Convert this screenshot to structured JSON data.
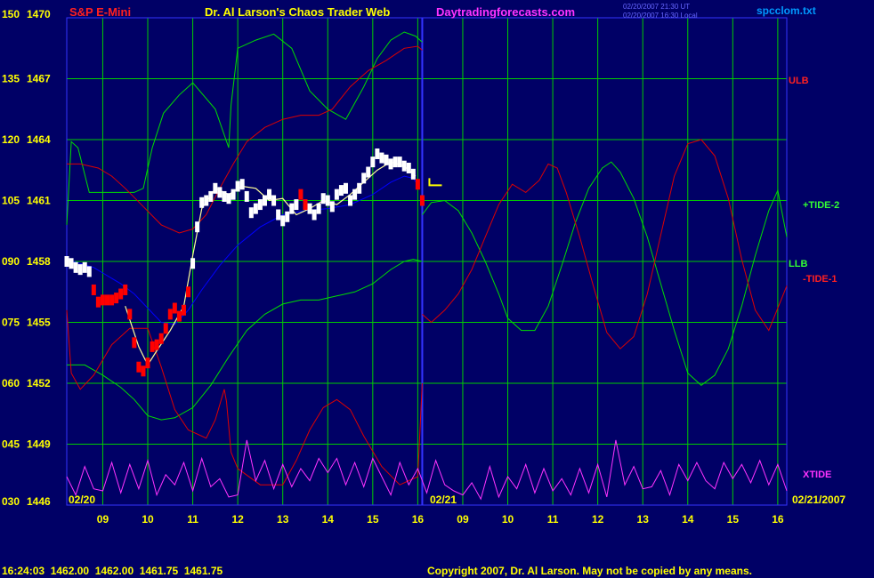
{
  "header": {
    "instrument": "S&P E-Mini",
    "site_title": "Dr. Al Larson's Chaos Trader Web",
    "site_url": "Daytradingforecasts.com",
    "timestamp_line1": "02/20/2007 21:30 UT",
    "timestamp_line2": "02/20/2007 16:30 Local",
    "data_file": "spcclom.txt"
  },
  "footer": {
    "quote": "16:24:03  1462.00  1462.00  1461.75  1461.75",
    "copyright": "Copyright 2007, Dr. Al Larson. May not be copied by any means."
  },
  "colors": {
    "background": "#000066",
    "border": "#000000",
    "grid": "#00cc00",
    "axis_text": "#ffff00",
    "title_red": "#ff2020",
    "title_yellow": "#ffff00",
    "title_magenta": "#ff33ff",
    "price_white": "#ffffff",
    "price_red": "#ff0000",
    "avg_blue": "#0000ff",
    "band_green": "#00dd00",
    "band_red": "#dd0000",
    "xtide_magenta": "#ff33ff",
    "divider_blue": "#3333ff"
  },
  "chart_data": {
    "type": "line",
    "title": "S&P E-Mini",
    "y_axis": {
      "ticks": [
        {
          "tide": "150",
          "price": "1470"
        },
        {
          "tide": "135",
          "price": "1467"
        },
        {
          "tide": "120",
          "price": "1464"
        },
        {
          "tide": "105",
          "price": "1461"
        },
        {
          "tide": "090",
          "price": "1458"
        },
        {
          "tide": "075",
          "price": "1455"
        },
        {
          "tide": "060",
          "price": "1452"
        },
        {
          "tide": "045",
          "price": "1449"
        },
        {
          "tide": "030",
          "price": "1446"
        }
      ],
      "price_range": [
        1446,
        1470
      ]
    },
    "x_axis": {
      "range": [
        8.2,
        24.2
      ],
      "ticks": [
        {
          "x": 9,
          "label": "09"
        },
        {
          "x": 10,
          "label": "10"
        },
        {
          "x": 11,
          "label": "11"
        },
        {
          "x": 12,
          "label": "12"
        },
        {
          "x": 13,
          "label": "13"
        },
        {
          "x": 14,
          "label": "14"
        },
        {
          "x": 15,
          "label": "15"
        },
        {
          "x": 16,
          "label": "16"
        },
        {
          "x": 17,
          "label": "09"
        },
        {
          "x": 18,
          "label": "10"
        },
        {
          "x": 19,
          "label": "11"
        },
        {
          "x": 20,
          "label": "12"
        },
        {
          "x": 21,
          "label": "13"
        },
        {
          "x": 22,
          "label": "14"
        },
        {
          "x": 23,
          "label": "15"
        },
        {
          "x": 24,
          "label": "16"
        }
      ],
      "date_left": "02/20",
      "date_mid": "02/21",
      "date_right": "02/21/2007",
      "divider_x": 16.1
    },
    "series_labels": {
      "ulb": "ULB",
      "tide2": "+TIDE-2",
      "llb": "LLB",
      "tide1": "-TIDE-1",
      "xtide": "XTIDE"
    },
    "series": [
      {
        "key": "upper_green",
        "color": "#00dd00",
        "x": [
          8.2,
          8.3,
          8.45,
          8.7,
          9.0,
          9.4,
          9.7,
          9.9,
          10.1,
          10.35,
          10.7,
          11.0,
          11.5,
          11.8,
          11.85,
          12.0,
          12.4,
          12.8,
          13.2,
          13.6,
          14.0,
          14.4,
          14.8,
          15.1,
          15.4,
          15.7,
          15.95,
          16.1
        ],
        "y": [
          1459.8,
          1463.9,
          1463.6,
          1461.4,
          1461.4,
          1461.4,
          1461.4,
          1461.6,
          1463.6,
          1465.3,
          1466.2,
          1466.8,
          1465.5,
          1463.6,
          1465.7,
          1468.5,
          1468.9,
          1469.2,
          1468.5,
          1466.4,
          1465.5,
          1465.0,
          1466.6,
          1468.0,
          1468.9,
          1469.3,
          1469.1,
          1468.8
        ]
      },
      {
        "key": "upper_red",
        "color": "#dd0000",
        "x": [
          8.2,
          8.5,
          8.9,
          9.2,
          9.5,
          9.9,
          10.3,
          10.7,
          11.0,
          11.3,
          11.6,
          11.9,
          12.2,
          12.6,
          13.0,
          13.4,
          13.8,
          14.1,
          14.5,
          14.9,
          15.3,
          15.7,
          16.0,
          16.1
        ],
        "y": [
          1462.8,
          1462.8,
          1462.6,
          1462.2,
          1461.6,
          1460.7,
          1459.8,
          1459.4,
          1459.6,
          1460.3,
          1461.6,
          1462.8,
          1463.9,
          1464.6,
          1465.0,
          1465.2,
          1465.2,
          1465.5,
          1466.6,
          1467.4,
          1467.9,
          1468.5,
          1468.6,
          1468.4
        ]
      },
      {
        "key": "lower_green",
        "color": "#00dd00",
        "x": [
          8.2,
          8.6,
          9.0,
          9.4,
          9.7,
          10.0,
          10.3,
          10.6,
          11.0,
          11.4,
          11.8,
          12.2,
          12.6,
          13.0,
          13.4,
          13.8,
          14.2,
          14.6,
          15.0,
          15.4,
          15.7,
          15.9,
          16.1
        ],
        "y": [
          1452.9,
          1452.9,
          1452.4,
          1451.8,
          1451.2,
          1450.4,
          1450.2,
          1450.3,
          1450.8,
          1451.9,
          1453.3,
          1454.6,
          1455.4,
          1455.9,
          1456.1,
          1456.1,
          1456.3,
          1456.5,
          1456.9,
          1457.6,
          1458.0,
          1458.1,
          1458.0
        ]
      },
      {
        "key": "lower_red",
        "color": "#dd0000",
        "x": [
          8.2,
          8.3,
          8.5,
          8.8,
          9.2,
          9.6,
          10.0,
          10.3,
          10.6,
          10.9,
          11.3,
          11.5,
          11.7,
          11.75,
          11.85,
          12.0,
          12.5,
          13.0,
          13.3,
          13.6,
          13.9,
          14.2,
          14.5,
          14.8,
          15.2,
          15.6,
          16.0,
          16.1
        ],
        "y": [
          1455.6,
          1452.5,
          1451.7,
          1452.4,
          1453.9,
          1454.7,
          1454.7,
          1452.8,
          1450.7,
          1449.7,
          1449.3,
          1450.2,
          1451.7,
          1451.1,
          1448.6,
          1447.8,
          1447.0,
          1447.0,
          1448.2,
          1449.7,
          1450.8,
          1451.2,
          1450.7,
          1449.4,
          1447.9,
          1447.0,
          1447.4,
          1452.0
        ]
      },
      {
        "key": "tide2",
        "color": "#00dd00",
        "x": [
          16.1,
          16.3,
          16.6,
          16.9,
          17.2,
          17.5,
          17.8,
          18.0,
          18.3,
          18.6,
          18.9,
          19.2,
          19.5,
          19.8,
          20.1,
          20.3,
          20.5,
          20.8,
          21.1,
          21.4,
          21.7,
          22.0,
          22.3,
          22.6,
          22.9,
          23.2,
          23.5,
          23.8,
          24.0,
          24.2
        ],
        "y": [
          1460.3,
          1460.9,
          1461.0,
          1460.5,
          1459.4,
          1458.0,
          1456.4,
          1455.2,
          1454.6,
          1454.6,
          1455.8,
          1457.8,
          1459.9,
          1461.6,
          1462.6,
          1462.9,
          1462.4,
          1461.1,
          1459.2,
          1456.9,
          1454.6,
          1452.5,
          1451.9,
          1452.4,
          1453.7,
          1455.8,
          1458.3,
          1460.5,
          1461.5,
          1459.2
        ]
      },
      {
        "key": "tide1",
        "color": "#dd0000",
        "x": [
          16.1,
          16.3,
          16.6,
          16.9,
          17.2,
          17.5,
          17.8,
          18.1,
          18.4,
          18.7,
          18.9,
          19.1,
          19.3,
          19.6,
          19.9,
          20.2,
          20.5,
          20.8,
          21.1,
          21.4,
          21.7,
          22.0,
          22.3,
          22.6,
          22.9,
          23.2,
          23.5,
          23.8,
          24.2
        ],
        "y": [
          1455.4,
          1455.0,
          1455.6,
          1456.4,
          1457.6,
          1459.2,
          1460.8,
          1461.8,
          1461.4,
          1462.0,
          1462.8,
          1462.6,
          1461.4,
          1459.2,
          1456.8,
          1454.5,
          1453.7,
          1454.3,
          1456.4,
          1459.3,
          1462.2,
          1463.8,
          1464.0,
          1463.2,
          1461.1,
          1458.1,
          1455.6,
          1454.6,
          1456.8
        ]
      },
      {
        "key": "xtide",
        "color": "#ff33ff",
        "x": [
          8.2,
          8.4,
          8.6,
          8.8,
          9.0,
          9.2,
          9.4,
          9.6,
          9.8,
          10.0,
          10.2,
          10.4,
          10.6,
          10.8,
          11.0,
          11.2,
          11.4,
          11.6,
          11.8,
          12.0,
          12.2,
          12.4,
          12.6,
          12.8,
          13.0,
          13.2,
          13.4,
          13.6,
          13.8,
          14.0,
          14.2,
          14.4,
          14.6,
          14.8,
          15.0,
          15.2,
          15.4,
          15.6,
          15.8,
          16.0,
          16.2,
          16.4,
          16.6,
          16.8,
          17.0,
          17.2,
          17.4,
          17.6,
          17.8,
          18.0,
          18.2,
          18.4,
          18.6,
          18.8,
          19.0,
          19.2,
          19.4,
          19.6,
          19.8,
          20.0,
          20.2,
          20.4,
          20.6,
          20.8,
          21.0,
          21.2,
          21.4,
          21.6,
          21.8,
          22.0,
          22.2,
          22.4,
          22.6,
          22.8,
          23.0,
          23.2,
          23.4,
          23.6,
          23.8,
          24.0,
          24.2
        ],
        "y": [
          1447.4,
          1446.5,
          1447.9,
          1446.8,
          1446.7,
          1448.1,
          1446.6,
          1448.0,
          1446.8,
          1448.2,
          1446.5,
          1447.5,
          1447.0,
          1448.1,
          1446.7,
          1448.3,
          1446.9,
          1447.3,
          1446.4,
          1446.5,
          1449.2,
          1447.2,
          1448.2,
          1446.8,
          1448.0,
          1446.9,
          1447.8,
          1447.2,
          1448.3,
          1447.6,
          1448.3,
          1447.0,
          1448.1,
          1446.9,
          1448.3,
          1447.4,
          1446.5,
          1448.1,
          1447.0,
          1447.8,
          1446.6,
          1448.2,
          1447.0,
          1446.7,
          1446.5,
          1447.1,
          1446.3,
          1447.9,
          1446.4,
          1447.4,
          1446.8,
          1448.0,
          1446.6,
          1447.8,
          1446.7,
          1447.3,
          1446.5,
          1447.8,
          1446.6,
          1448.0,
          1446.4,
          1449.2,
          1447.0,
          1447.9,
          1446.8,
          1446.9,
          1447.7,
          1446.5,
          1448.0,
          1447.2,
          1448.1,
          1447.2,
          1446.8,
          1448.1,
          1447.3,
          1448.0,
          1447.1,
          1448.2,
          1447.0,
          1448.0,
          1446.7
        ]
      },
      {
        "key": "price_avg",
        "color": "#0000ff",
        "x": [
          8.2,
          8.5,
          8.8,
          9.1,
          9.4,
          9.7,
          10.0,
          10.3,
          10.6,
          10.9,
          11.2,
          11.6,
          12.0,
          12.5,
          13.0,
          13.5,
          14.0,
          14.5,
          15.0,
          15.4,
          15.7,
          15.9,
          16.05
        ],
        "y": [
          1458.1,
          1457.9,
          1457.7,
          1457.3,
          1456.9,
          1456.4,
          1455.7,
          1455.0,
          1454.9,
          1455.6,
          1456.6,
          1457.8,
          1458.8,
          1459.7,
          1460.3,
          1460.5,
          1460.6,
          1460.8,
          1461.3,
          1461.9,
          1462.2,
          1462.1,
          1461.6
        ]
      },
      {
        "key": "price_smooth",
        "color": "#ffff99",
        "x": [
          9.5,
          9.8,
          10.0,
          10.2,
          10.5,
          10.8,
          11.0,
          11.2,
          11.5,
          11.8,
          12.1,
          12.4,
          12.7,
          13.0,
          13.3,
          13.6,
          13.9,
          14.2,
          14.5,
          14.8,
          15.1,
          15.4,
          15.7,
          15.95
        ],
        "y": [
          1455.8,
          1453.8,
          1452.9,
          1453.6,
          1454.6,
          1455.8,
          1458.3,
          1460.6,
          1461.6,
          1461.3,
          1461.7,
          1461.6,
          1461.0,
          1461.1,
          1460.3,
          1460.6,
          1461.0,
          1460.8,
          1461.3,
          1461.9,
          1462.5,
          1462.9,
          1462.7,
          1462.2
        ]
      },
      {
        "key": "price_bars",
        "color": "#ffffff",
        "x": [
          8.2,
          8.3,
          8.4,
          8.5,
          8.6,
          8.7,
          8.8,
          8.9,
          9.0,
          9.1,
          9.2,
          9.3,
          9.4,
          9.5,
          9.6,
          9.7,
          9.8,
          9.9,
          10.0,
          10.1,
          10.2,
          10.3,
          10.4,
          10.5,
          10.6,
          10.7,
          10.8,
          10.9,
          11.0,
          11.1,
          11.2,
          11.3,
          11.4,
          11.5,
          11.6,
          11.7,
          11.8,
          11.9,
          12.0,
          12.1,
          12.2,
          12.3,
          12.4,
          12.5,
          12.6,
          12.7,
          12.8,
          12.9,
          13.0,
          13.1,
          13.2,
          13.3,
          13.4,
          13.5,
          13.6,
          13.7,
          13.8,
          13.9,
          14.0,
          14.1,
          14.2,
          14.3,
          14.4,
          14.5,
          14.6,
          14.7,
          14.8,
          14.9,
          15.0,
          15.1,
          15.2,
          15.3,
          15.4,
          15.5,
          15.6,
          15.7,
          15.8,
          15.9,
          16.0,
          16.1
        ],
        "y": [
          1458.0,
          1457.9,
          1457.7,
          1457.6,
          1457.7,
          1457.5,
          1456.6,
          1456.0,
          1456.1,
          1456.1,
          1456.1,
          1456.2,
          1456.4,
          1456.6,
          1455.4,
          1454.0,
          1452.8,
          1452.6,
          1453.0,
          1453.8,
          1453.9,
          1454.2,
          1454.7,
          1455.4,
          1455.7,
          1455.3,
          1455.6,
          1456.5,
          1457.9,
          1459.7,
          1460.9,
          1461.0,
          1461.2,
          1461.6,
          1461.4,
          1461.2,
          1461.1,
          1461.3,
          1461.7,
          1461.8,
          1461.2,
          1460.4,
          1460.6,
          1460.8,
          1461.0,
          1461.3,
          1461.0,
          1460.3,
          1460.0,
          1460.2,
          1460.6,
          1460.8,
          1461.3,
          1460.8,
          1460.6,
          1460.3,
          1460.6,
          1461.1,
          1461.0,
          1460.7,
          1461.3,
          1461.5,
          1461.6,
          1461.0,
          1461.3,
          1461.6,
          1462.1,
          1462.4,
          1462.9,
          1463.3,
          1463.1,
          1463.0,
          1462.8,
          1462.9,
          1462.9,
          1462.7,
          1462.6,
          1462.3,
          1461.8,
          1461.0
        ],
        "red_bars": [
          6,
          7,
          8,
          9,
          10,
          11,
          12,
          13,
          14,
          15,
          16,
          17,
          18,
          19,
          20,
          21,
          22,
          23,
          24,
          25,
          26,
          27,
          52,
          53,
          78,
          79
        ]
      }
    ],
    "last_price": 1461.75
  }
}
